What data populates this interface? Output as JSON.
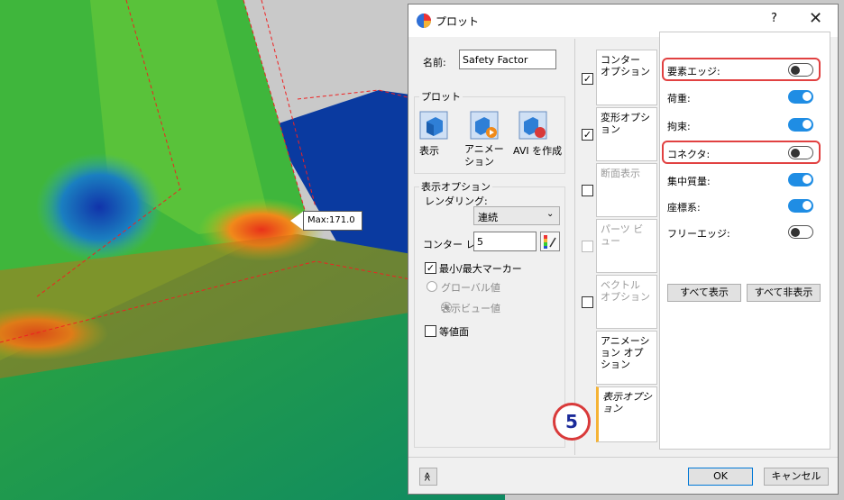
{
  "viewport": {
    "max_marker": "Max:171.0"
  },
  "dialog": {
    "title": "プロット",
    "help": "?",
    "close": "✕",
    "name_label": "名前:",
    "name_value": "Safety Factor",
    "plot_group": {
      "legend": "プロット",
      "show_label": "表示",
      "animation_label": "アニメーション",
      "avi_label": "AVI を作成"
    },
    "display_options": {
      "legend": "表示オプション",
      "rendering_label": "レンダリング:",
      "rendering_value": "連続",
      "contour_label": "コンター レ",
      "contour_value": "5",
      "minmax_marker_label": "最小/最大マーカー",
      "minmax_checked": true,
      "global_value_label": "グローバル値",
      "view_value_label": "表示ビュー値",
      "isosurface_label": "等値面",
      "isosurface_checked": false
    },
    "tabs": [
      {
        "label": "コンター オプション",
        "checked": true,
        "dim": false
      },
      {
        "label": "変形オプション",
        "checked": true,
        "dim": false
      },
      {
        "label": "断面表示",
        "checked": false,
        "dim": true
      },
      {
        "label": "パーツ ビュー",
        "checked": false,
        "dim": true,
        "disabled": true
      },
      {
        "label": "ベクトル オプション",
        "checked": false,
        "dim": true
      },
      {
        "label": "アニメーション オプション",
        "checked": null,
        "dim": false
      },
      {
        "label": "表示オプション",
        "checked": null,
        "dim": false,
        "active": true
      }
    ],
    "toggles": [
      {
        "label": "要素エッジ:",
        "on": false,
        "highlighted": true
      },
      {
        "label": "荷重:",
        "on": true,
        "highlighted": false
      },
      {
        "label": "拘束:",
        "on": true,
        "highlighted": false
      },
      {
        "label": "コネクタ:",
        "on": false,
        "highlighted": true
      },
      {
        "label": "集中質量:",
        "on": true,
        "highlighted": false
      },
      {
        "label": "座標系:",
        "on": true,
        "highlighted": false
      },
      {
        "label": "フリーエッジ:",
        "on": false,
        "highlighted": false
      }
    ],
    "show_all": "すべて表示",
    "hide_all": "すべて非表示",
    "ok": "OK",
    "cancel": "キャンセル",
    "collapse": "≫"
  },
  "step_badge": "5",
  "colors": {
    "accent": "#1f8de4",
    "highlight": "#e14141",
    "active_tab": "#f5b335"
  }
}
